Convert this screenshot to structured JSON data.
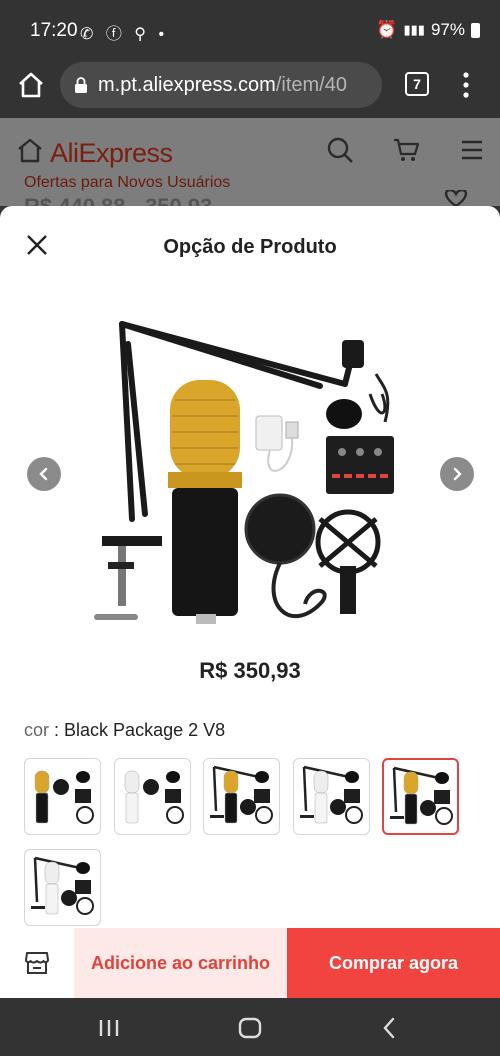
{
  "status": {
    "time": "17:20",
    "battery": "97%",
    "left_icons": [
      "whatsapp-icon",
      "facebook-icon",
      "location-icon",
      "dot-icon"
    ],
    "right_icons": [
      "alarm-icon",
      "mute-icon",
      "wifi-icon",
      "volte-icon",
      "signal-icon",
      "battery-icon"
    ]
  },
  "browser": {
    "url_host": "m.pt.aliexpress.com",
    "url_path": "/item/40",
    "tab_count": "7"
  },
  "site": {
    "logo": "AliExpress",
    "promo": "Ofertas para Novos Usuários",
    "price_ghost": "R$ 440,88 - 350,93"
  },
  "sheet": {
    "title": "Opção de Produto",
    "price": "R$ 350,93",
    "color_key": "cor",
    "color_value": "Black Package 2 V8",
    "variants": [
      {
        "name": "variant-gold-mic-kit",
        "mic": "gold",
        "arm": false
      },
      {
        "name": "variant-white-mic-kit",
        "mic": "white",
        "arm": false
      },
      {
        "name": "variant-gold-mic-arm-kit",
        "mic": "gold",
        "arm": true
      },
      {
        "name": "variant-white-mic-arm-kit",
        "mic": "white",
        "arm": true
      },
      {
        "name": "variant-black-package-v8",
        "mic": "gold",
        "arm": true,
        "selected": true
      },
      {
        "name": "variant-white-package-v8",
        "mic": "white",
        "arm": true
      }
    ]
  },
  "actions": {
    "add_to_cart": "Adicione ao carrinho",
    "buy_now": "Comprar agora"
  },
  "colors": {
    "accent": "#f1433f",
    "accent_light": "#fde9e7",
    "system_bar": "#333333"
  }
}
